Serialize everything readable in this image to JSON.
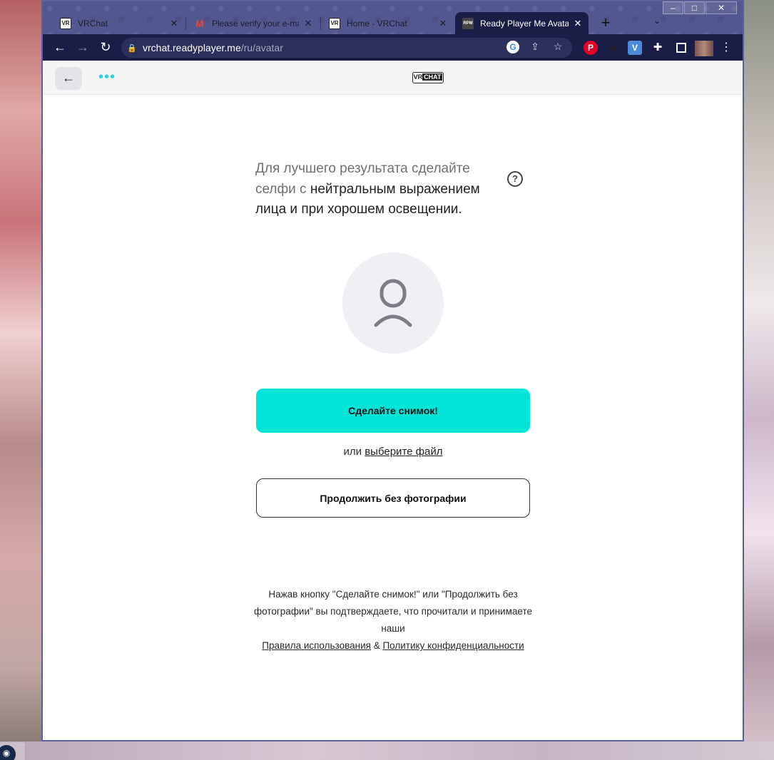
{
  "browser": {
    "tabs": [
      {
        "title": "VRChat",
        "favicon": "vrchat-icon"
      },
      {
        "title": "Please verify your e-mail",
        "favicon": "gmail-icon"
      },
      {
        "title": "Home - VRChat",
        "favicon": "vrchat-icon"
      },
      {
        "title": "Ready Player Me Avatar",
        "favicon": "readyplayerme-icon"
      }
    ],
    "url_host": "vrchat.readyplayer.me",
    "url_path": "/ru/avatar"
  },
  "page": {
    "logo_vr": "VR",
    "logo_chat": "CHAT",
    "intro_plain": "Для лучшего результата сделайте селфи с ",
    "intro_emphasis": "нейтральным выражением лица и при хорошем освещении.",
    "take_photo_label": "Сделайте снимок!",
    "or_text": "или ",
    "choose_file_label": "выберите файл",
    "continue_label": "Продолжить без фотографии",
    "legal_text": "Нажав кнопку \"Сделайте снимок!\" или \"Продолжить без фотографии\" вы подтверждаете, что прочитали и принимаете наши",
    "terms_link": "Правила использования",
    "amp": " & ",
    "privacy_link": "Политику конфиденциальности"
  },
  "colors": {
    "accent": "#00e5d8",
    "tabstrip": "#53578f",
    "toolbar": "#1a1d45"
  }
}
